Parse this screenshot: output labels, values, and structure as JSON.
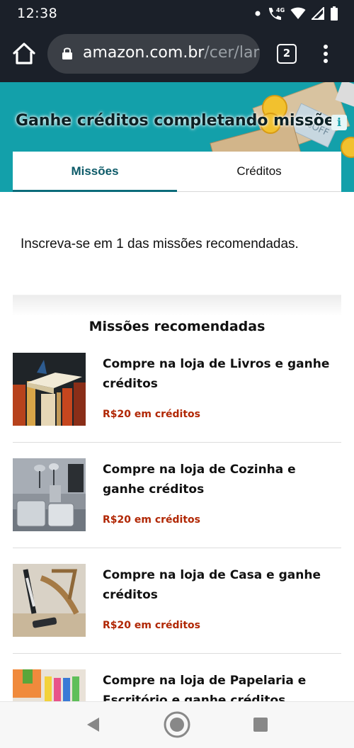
{
  "status_bar": {
    "time": "12:38",
    "network": "4G",
    "icons": [
      "notification-dot-icon",
      "wifi-call-icon",
      "wifi-icon",
      "signal-icon",
      "battery-icon"
    ]
  },
  "browser": {
    "url_host": "amazon.com.br",
    "url_path": "/cer/lanc",
    "tab_count": "2"
  },
  "banner": {
    "title": "Ganhe créditos completando missões",
    "info_label": "i",
    "bg_color": "#13a0aa"
  },
  "tabs": [
    {
      "label": "Missões",
      "active": true
    },
    {
      "label": "Créditos",
      "active": false
    }
  ],
  "enroll_text": "Inscreva-se em 1 das missões recomendadas.",
  "section_title": "Missões recomendadas",
  "missions": [
    {
      "name": "Compre na loja de Livros e ganhe créditos",
      "reward": "R$20 em créditos",
      "thumb": "books-image"
    },
    {
      "name": "Compre na loja de Cozinha e ganhe créditos",
      "reward": "R$20 em créditos",
      "thumb": "kitchen-image"
    },
    {
      "name": "Compre na loja de Casa e ganhe créditos",
      "reward": "R$20 em créditos",
      "thumb": "home-vacuum-image"
    },
    {
      "name": "Compre na loja de Papelaria e Escritório e ganhe créditos",
      "reward": "",
      "thumb": "stationery-image"
    }
  ],
  "colors": {
    "accent": "#0c6b7a",
    "reward": "#b12704",
    "toolbar": "#1b2029"
  }
}
